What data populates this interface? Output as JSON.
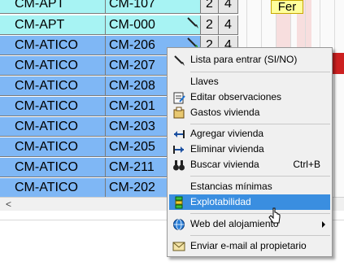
{
  "grid": {
    "rows": [
      {
        "name": "CM-APT",
        "code": "CM-107",
        "n1": "2",
        "n2": "4",
        "tone": "cyan",
        "pen": false
      },
      {
        "name": "CM-APT",
        "code": "CM-000",
        "n1": "2",
        "n2": "4",
        "tone": "cyan",
        "pen": true
      },
      {
        "name": "CM-ATICO",
        "code": "CM-206",
        "n1": "2",
        "n2": "4",
        "tone": "blue",
        "pen": true
      },
      {
        "name": "CM-ATICO",
        "code": "CM-207",
        "n1": "",
        "n2": "",
        "tone": "blue",
        "pen": false
      },
      {
        "name": "CM-ATICO",
        "code": "CM-208",
        "n1": "",
        "n2": "",
        "tone": "blue",
        "pen": false
      },
      {
        "name": "CM-ATICO",
        "code": "CM-201",
        "n1": "",
        "n2": "",
        "tone": "blue",
        "pen": false
      },
      {
        "name": "CM-ATICO",
        "code": "CM-203",
        "n1": "",
        "n2": "",
        "tone": "blue",
        "pen": false
      },
      {
        "name": "CM-ATICO",
        "code": "CM-205",
        "n1": "",
        "n2": "",
        "tone": "blue",
        "pen": false
      },
      {
        "name": "CM-ATICO",
        "code": "CM-211",
        "n1": "",
        "n2": "",
        "tone": "blue",
        "pen": false
      },
      {
        "name": "CM-ATICO",
        "code": "CM-202",
        "n1": "",
        "n2": "",
        "tone": "blue",
        "pen": false
      }
    ],
    "fer_label": "Fer"
  },
  "scrollbar": {
    "left_arrow": "<"
  },
  "context_menu": {
    "items": {
      "lista": {
        "label": "Lista para entrar (SI/NO)",
        "icon": "pen-icon"
      },
      "llaves": {
        "label": "Llaves"
      },
      "observaciones": {
        "label": "Editar observaciones",
        "icon": "edit-notes-icon"
      },
      "gastos": {
        "label": "Gastos vivienda",
        "icon": "expenses-icon"
      },
      "agregar": {
        "label": "Agregar vivienda",
        "icon": "add-arrow-icon"
      },
      "eliminar": {
        "label": "Eliminar vivienda",
        "icon": "remove-arrow-icon"
      },
      "buscar": {
        "label": "Buscar vivienda",
        "shortcut": "Ctrl+B",
        "icon": "binoculars-icon"
      },
      "estancias": {
        "label": "Estancias mínimas"
      },
      "explotabilidad": {
        "label": "Explotabilidad",
        "icon": "stacked-bars-icon"
      },
      "web": {
        "label": "Web del alojamiento",
        "icon": "globe-icon"
      },
      "email": {
        "label": "Enviar e-mail al propietario",
        "icon": "envelope-icon"
      }
    },
    "highlight_color": "#3a8ee0"
  },
  "colors": {
    "cyan_row": "#a7f3f3",
    "blue_row": "#7fb7f5",
    "fer_bg": "#ffff9c"
  }
}
